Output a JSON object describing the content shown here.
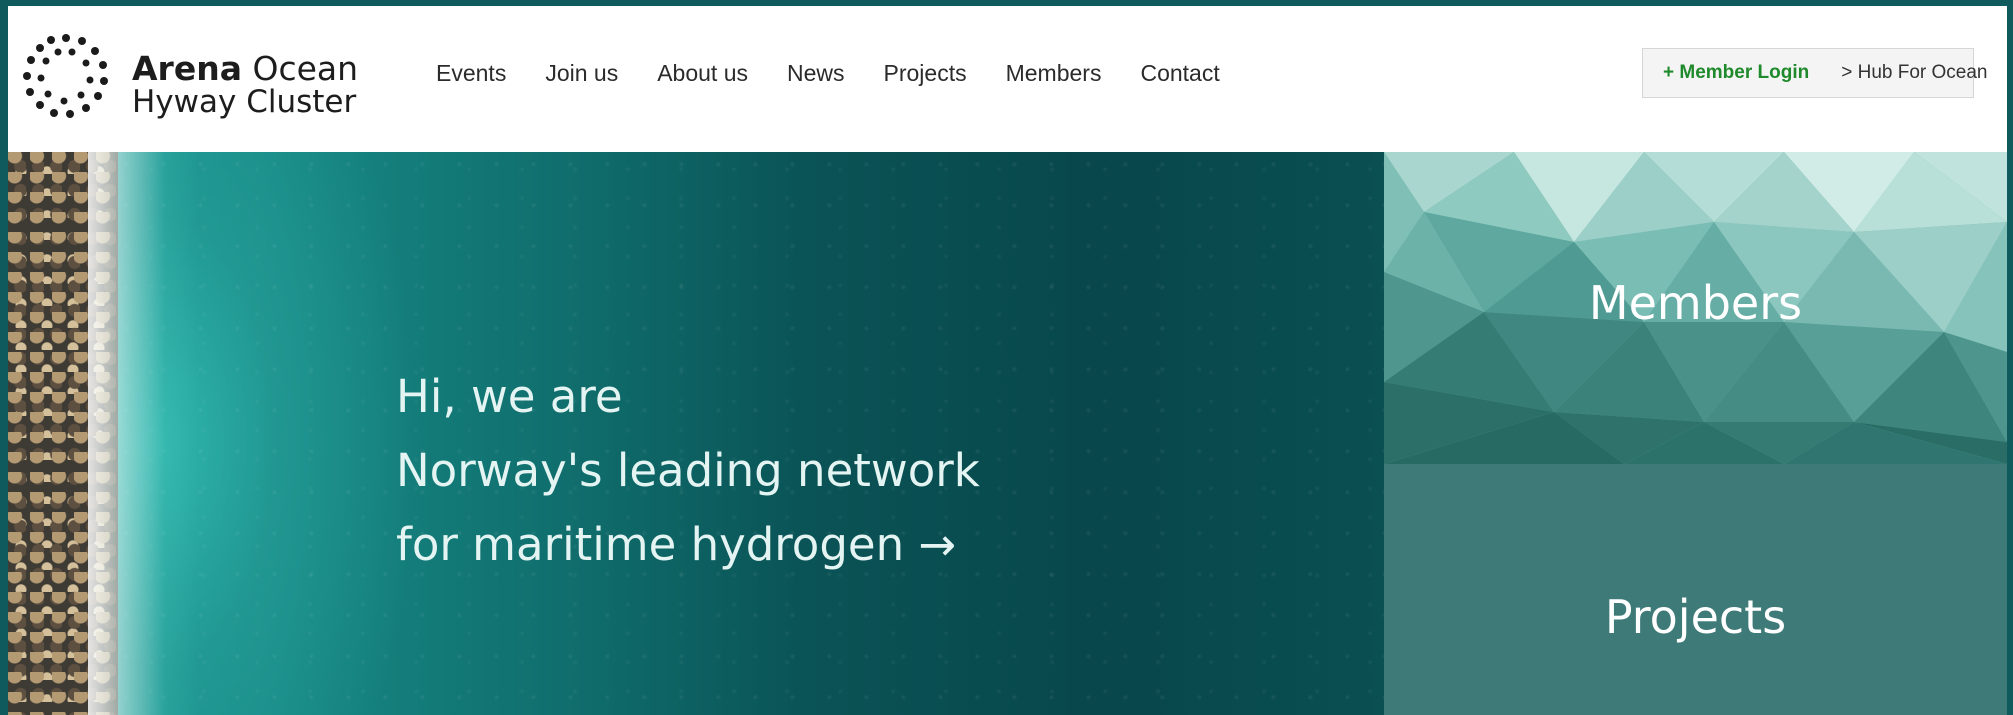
{
  "header": {
    "logo": {
      "name_bold": "Arena",
      "name_rest": "Ocean",
      "line2": "Hyway Cluster"
    },
    "nav": [
      "Events",
      "Join us",
      "About us",
      "News",
      "Projects",
      "Members",
      "Contact"
    ],
    "member_login": "+ Member Login",
    "hub_link": "> Hub For Ocean"
  },
  "hero": {
    "lines": [
      "Hi, we are",
      "Norway's leading network",
      "for maritime hydrogen →"
    ]
  },
  "tiles": {
    "members": "Members",
    "projects": "Projects"
  },
  "colors": {
    "frame": "#0f5a5c",
    "login_green": "#1f8a2b",
    "members_tile": "#6fb6ad",
    "projects_tile": "#3e7a78"
  }
}
